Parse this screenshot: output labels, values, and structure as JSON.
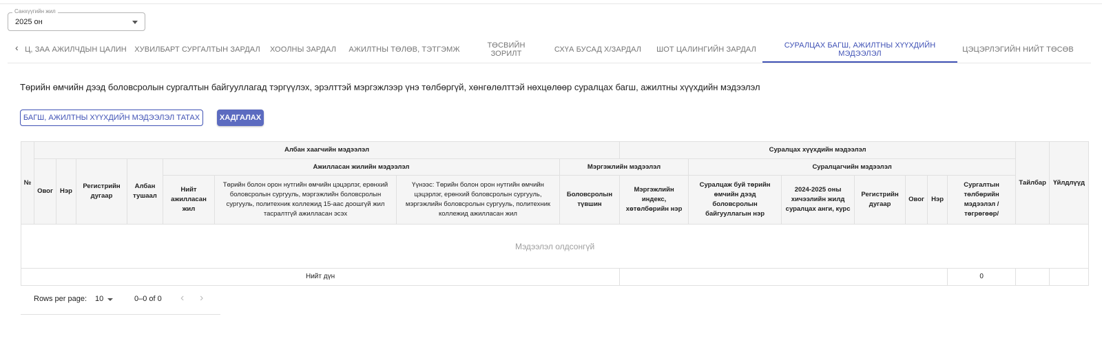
{
  "fiscal_year": {
    "label": "Санхүүгийн жил",
    "value": "2025 он"
  },
  "tabs": [
    {
      "label": "Ц, ЗАА АЖИЛЧДЫН ЦАЛИН"
    },
    {
      "label": "ХУВИЛБАРТ СУРГАЛТЫН ЗАРДАЛ"
    },
    {
      "label": "ХООЛНЫ ЗАРДАЛ"
    },
    {
      "label": "АЖИЛТНЫ ТӨЛӨВ, ТЭТГЭМЖ"
    },
    {
      "label": "ТӨСВИЙН ЗОРИЛТ"
    },
    {
      "label": "СХҮА БУСАД Х/ЗАРДАЛ"
    },
    {
      "label": "ШОТ ЦАЛИНГИЙН ЗАРДАЛ"
    },
    {
      "label": "СУРАЛЦАХ БАГШ, АЖИЛТНЫ ХҮҮХДИЙН МЭДЭЭЛЭЛ",
      "active": true
    },
    {
      "label": "ЦЭЦЭРЛЭГИЙН НИЙТ ТӨСӨВ"
    }
  ],
  "description": "Төрийн өмчийн дээд боловсролын сургалтын байгууллагад тэргүүлэх, эрэлттэй мэргэжлээр үнэ төлбөргүй, хөнгөлөлттэй нөхцөлөөр суралцах багш, ажилтны хүүхдийн мэдээлэл",
  "buttons": {
    "download": "БАГШ, АЖИЛТНЫ ХҮҮХДИЙН МЭДЭЭЛЭЛ ТАТАХ",
    "save": "ХАДГАЛАХ"
  },
  "table": {
    "no": "№",
    "group_employee": "Албан хаагчийн мэдээлэл",
    "group_child": "Суралцах хүүхдийн мэдээлэл",
    "group_worked": "Ажилласан жилийн мэдээлэл",
    "group_profession": "Мэргэжлийн мэдээлэл",
    "group_student": "Суралцагчийн мэдээлэл",
    "col_lastname": "Овог",
    "col_firstname": "Нэр",
    "col_register": "Регистрийн дугаар",
    "col_position": "Албан тушаал",
    "col_total_years": "Нийт ажилласан жил",
    "col_state_years": "Төрийн болон орон нутгийн өмчийн цэцэрлэг, ерөнхий боловсролын сургууль, мэргэжлийн боловсролын сургууль, политехник коллежид 15-аас доошгүй жил тасралтгүй ажилласан эсэх",
    "col_of_which": "Үүнээс: Төрийн болон орон нутгийн өмчийн цэцэрлэг, ерөнхий боловсролын сургууль, мэргэжлийн боловсролын сургууль, политехник коллежид ажилласан жил",
    "col_edu_level": "Боловсролын түвшин",
    "col_prof_index": "Мэргэжлийн индекс, хөтөлбөрийн нэр",
    "col_institution": "Суралцаж буй төрийн өмчийн дээд боловсролын байгууллагын нэр",
    "col_course": "2024-2025 оны хичээлийн жилд суралцах анги, курс",
    "col_stu_register": "Регистрийн дугаар",
    "col_stu_lastname": "Овог",
    "col_stu_firstname": "Нэр",
    "col_tuition": "Сургалтын төлбөрийн мэдээлэл /төгрөгөөр/",
    "col_note": "Тайлбар",
    "col_actions": "Үйлдлүүд",
    "empty_message": "Мэдээлэл олдсонгүй",
    "total_label": "Нийт дүн",
    "total_value": "0"
  },
  "pagination": {
    "rows_per_page_label": "Rows per page:",
    "rows_per_page": "10",
    "range": "0–0 of 0"
  },
  "colors": {
    "accent": "#3f51b5",
    "primary_button": "#5c6bc0",
    "header_bg": "#f5f5f5"
  },
  "icons": {
    "tab_scroll_left": "chevron-left-icon",
    "select": "arrow-drop-down-icon",
    "prev": "chevron-left-icon",
    "next": "chevron-right-icon"
  }
}
